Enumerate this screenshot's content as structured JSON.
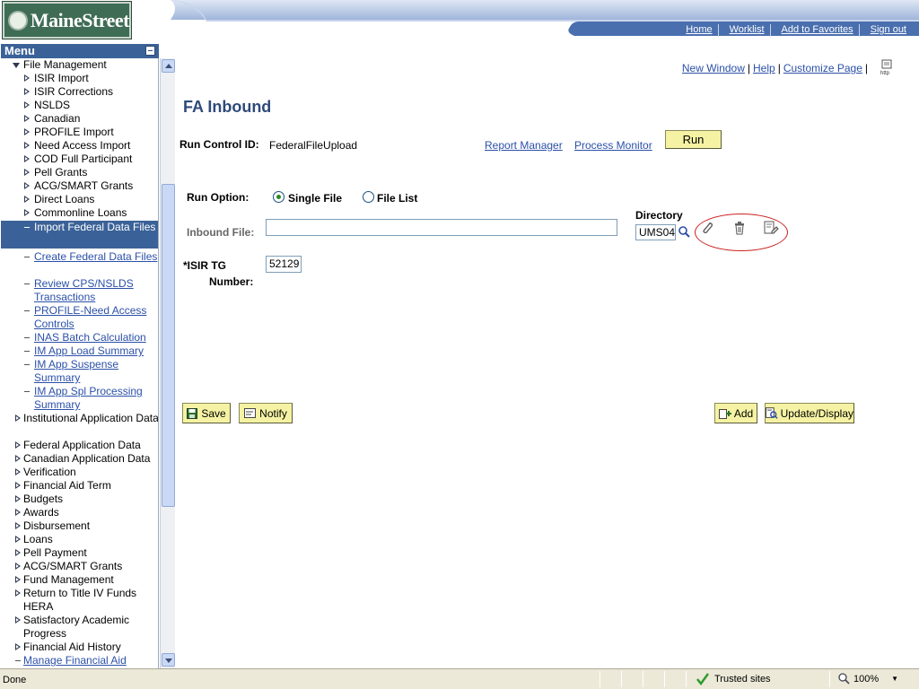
{
  "header": {
    "logo_text": "MaineStreet",
    "links": [
      "Home",
      "Worklist",
      "Add to Favorites",
      "Sign out"
    ],
    "band_color": "#4a6fae"
  },
  "menu": {
    "title": "Menu",
    "items": [
      {
        "label": "File Management",
        "kind": "expanded"
      },
      {
        "label": "ISIR Import",
        "kind": "folder"
      },
      {
        "label": "ISIR Corrections",
        "kind": "folder"
      },
      {
        "label": "NSLDS",
        "kind": "folder"
      },
      {
        "label": "Canadian",
        "kind": "folder"
      },
      {
        "label": "PROFILE Import",
        "kind": "folder"
      },
      {
        "label": "Need Access Import",
        "kind": "folder"
      },
      {
        "label": "COD Full Participant",
        "kind": "folder"
      },
      {
        "label": "Pell Grants",
        "kind": "folder"
      },
      {
        "label": "ACG/SMART Grants",
        "kind": "folder"
      },
      {
        "label": "Direct Loans",
        "kind": "folder"
      },
      {
        "label": "Commonline Loans",
        "kind": "folder"
      },
      {
        "label": "Import Federal Data Files",
        "kind": "selected"
      },
      {
        "label": "Create Federal Data Files",
        "kind": "link"
      },
      {
        "label": "Review CPS/NSLDS Transactions",
        "kind": "link"
      },
      {
        "label": "PROFILE-Need Access Controls",
        "kind": "link"
      },
      {
        "label": "INAS Batch Calculation",
        "kind": "link"
      },
      {
        "label": "IM App Load Summary",
        "kind": "link"
      },
      {
        "label": "IM App Suspense Summary",
        "kind": "link"
      },
      {
        "label": "IM App Spl Processing Summary",
        "kind": "link"
      },
      {
        "label": "Institutional Application Data",
        "kind": "folder"
      },
      {
        "label": "Federal Application Data",
        "kind": "folder"
      },
      {
        "label": "Canadian Application Data",
        "kind": "folder"
      },
      {
        "label": "Verification",
        "kind": "folder"
      },
      {
        "label": "Financial Aid Term",
        "kind": "folder"
      },
      {
        "label": "Budgets",
        "kind": "folder"
      },
      {
        "label": "Awards",
        "kind": "folder"
      },
      {
        "label": "Disbursement",
        "kind": "folder"
      },
      {
        "label": "Loans",
        "kind": "folder"
      },
      {
        "label": "Pell Payment",
        "kind": "folder"
      },
      {
        "label": "ACG/SMART Grants",
        "kind": "folder"
      },
      {
        "label": "Fund Management",
        "kind": "folder"
      },
      {
        "label": "Return to Title IV Funds HERA",
        "kind": "folder"
      },
      {
        "label": "Satisfactory Academic Progress",
        "kind": "folder"
      },
      {
        "label": "Financial Aid History",
        "kind": "folder"
      },
      {
        "label": "Manage Financial Aid",
        "kind": "link"
      }
    ]
  },
  "top_links": {
    "new_window": "New Window",
    "help": "Help",
    "customize": "Customize Page"
  },
  "page": {
    "title": "FA Inbound",
    "run_control_label": "Run Control ID:",
    "run_control_value": "FederalFileUpload",
    "report_manager": "Report Manager",
    "process_monitor": "Process Monitor",
    "run_button": "Run",
    "run_option_label": "Run Option:",
    "option_single": "Single File",
    "option_list": "File List",
    "selected_option": "Single File",
    "inbound_file_label": "Inbound File:",
    "inbound_file_value": "",
    "directory_label": "Directory",
    "directory_value": "UMS04",
    "isir_label_line1": "*ISIR TG",
    "isir_label_line2": "Number:",
    "isir_value": "52129"
  },
  "buttons": {
    "save": "Save",
    "notify": "Notify",
    "add": "Add",
    "update_display": "Update/Display"
  },
  "statusbar": {
    "status": "Done",
    "zone": "Trusted sites",
    "zoom": "100%"
  }
}
